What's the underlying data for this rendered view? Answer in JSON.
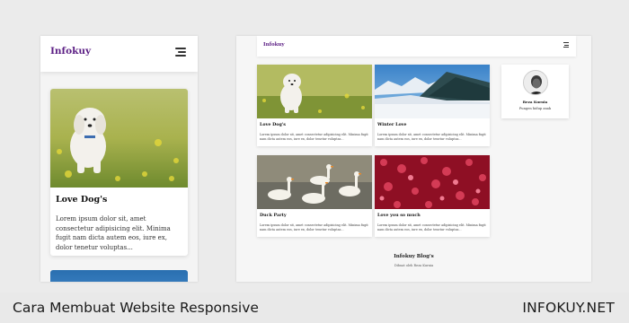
{
  "mobile": {
    "brand": "Infokuy",
    "menu_icon": "hamburger-icon",
    "card": {
      "title": "Love Dog's",
      "text": "Lorem ipsum dolor sit, amet consectetur adipisicing elit. Minima fugit nam dicta autem eos, iure ex, dolor tenetur voluptas...",
      "image": "dog-photo"
    },
    "next_card_image": "winter-photo"
  },
  "desktop": {
    "brand": "Infokuy",
    "menu_icon": "hamburger-icon",
    "cards": [
      {
        "title": "Love Dog's",
        "text": "Lorem ipsum dolor sit, amet consectetur adipisicing elit. Minima fugit nam dicta autem eos, iure ex, dolor tenetur voluptas...",
        "image": "dog-photo"
      },
      {
        "title": "Winter Love",
        "text": "Lorem ipsum dolor sit, amet consectetur adipisicing elit. Minima fugit nam dicta autem eos, iure ex, dolor tenetur voluptas...",
        "image": "winter-photo"
      },
      {
        "title": "Duck Party",
        "text": "Lorem ipsum dolor sit, amet consectetur adipisicing elit. Minima fugit nam dicta autem eos, iure ex, dolor tenetur voluptas...",
        "image": "ducks-photo"
      },
      {
        "title": "Love you so much",
        "text": "Lorem ipsum dolor sit, amet consectetur adipisicing elit. Minima fugit nam dicta autem eos, iure ex, dolor tenetur voluptas...",
        "image": "hearts-photo"
      }
    ],
    "profile": {
      "name": "Reza Kurnia",
      "role": "Pungen hidup anak"
    },
    "footer": {
      "title": "Infokuy Blog's",
      "subtitle": "Dibuat oleh Reza Kurnia"
    }
  },
  "caption": {
    "left": "Cara Membuat Website Responsive",
    "right": "INFOKUY.NET"
  },
  "colors": {
    "brand": "#5b1e84",
    "background": "#ebebeb",
    "card": "#ffffff"
  }
}
